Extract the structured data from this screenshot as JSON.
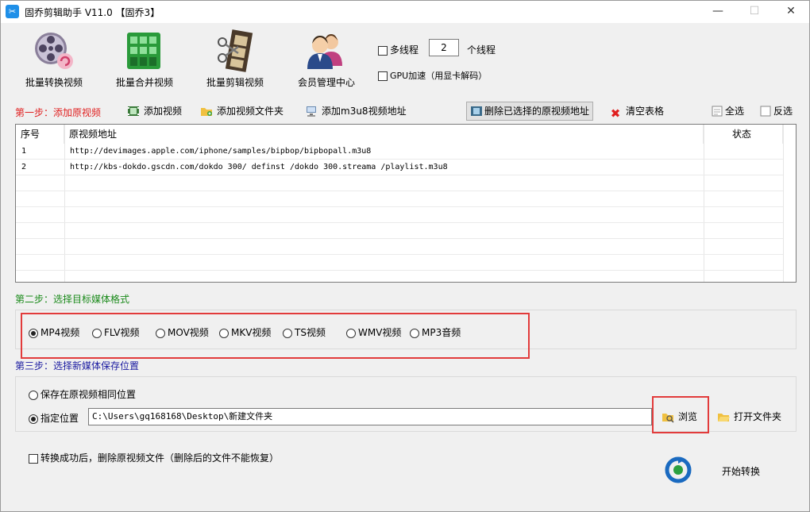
{
  "window": {
    "title": "固乔剪辑助手 V11.0  【固乔3】",
    "minimize": "—",
    "maximize": "☐",
    "close": "✕"
  },
  "toolbar": {
    "batch_convert": "批量转换视频",
    "batch_merge": "批量合并视频",
    "batch_cut": "批量剪辑视频",
    "member_center": "会员管理中心",
    "multithread_label": "多线程",
    "thread_count": "2",
    "thread_unit": "个线程",
    "gpu_label": "GPU加速（用显卡解码）"
  },
  "step1": {
    "label": "第一步：添加原视频",
    "add_video": "添加视频",
    "add_folder": "添加视频文件夹",
    "add_m3u8": "添加m3u8视频地址",
    "delete_selected": "删除已选择的原视频地址",
    "clear_table": "清空表格",
    "select_all": "全选",
    "invert_select": "反选"
  },
  "table": {
    "columns": [
      "序号",
      "原视频地址",
      "状态"
    ],
    "rows": [
      {
        "index": "1",
        "url": "http://devimages.apple.com/iphone/samples/bipbop/bipbopall.m3u8",
        "status": ""
      },
      {
        "index": "2",
        "url": "http://kbs-dokdo.gscdn.com/dokdo 300/ definst /dokdo 300.streama /playlist.m3u8",
        "status": ""
      }
    ]
  },
  "step2": {
    "label": "第二步：选择目标媒体格式",
    "options": [
      "MP4视频",
      "FLV视频",
      "MOV视频",
      "MKV视频",
      "TS视频",
      "WMV视频",
      "MP3音频"
    ],
    "selected": "MP4视频"
  },
  "step3": {
    "label": "第三步：选择新媒体保存位置",
    "same_location": "保存在原视频相同位置",
    "custom_location": "指定位置",
    "path": "C:\\Users\\gq168168\\Desktop\\新建文件夹",
    "browse": "浏览",
    "open_folder": "打开文件夹"
  },
  "footer": {
    "delete_after": "转换成功后，删除原视频文件（删除后的文件不能恢复）",
    "start": "开始转换"
  },
  "colors": {
    "step1": "#e02020",
    "step2": "#1a8a1a",
    "step3": "#1a1aa0",
    "highlight": "#e23b3b"
  }
}
